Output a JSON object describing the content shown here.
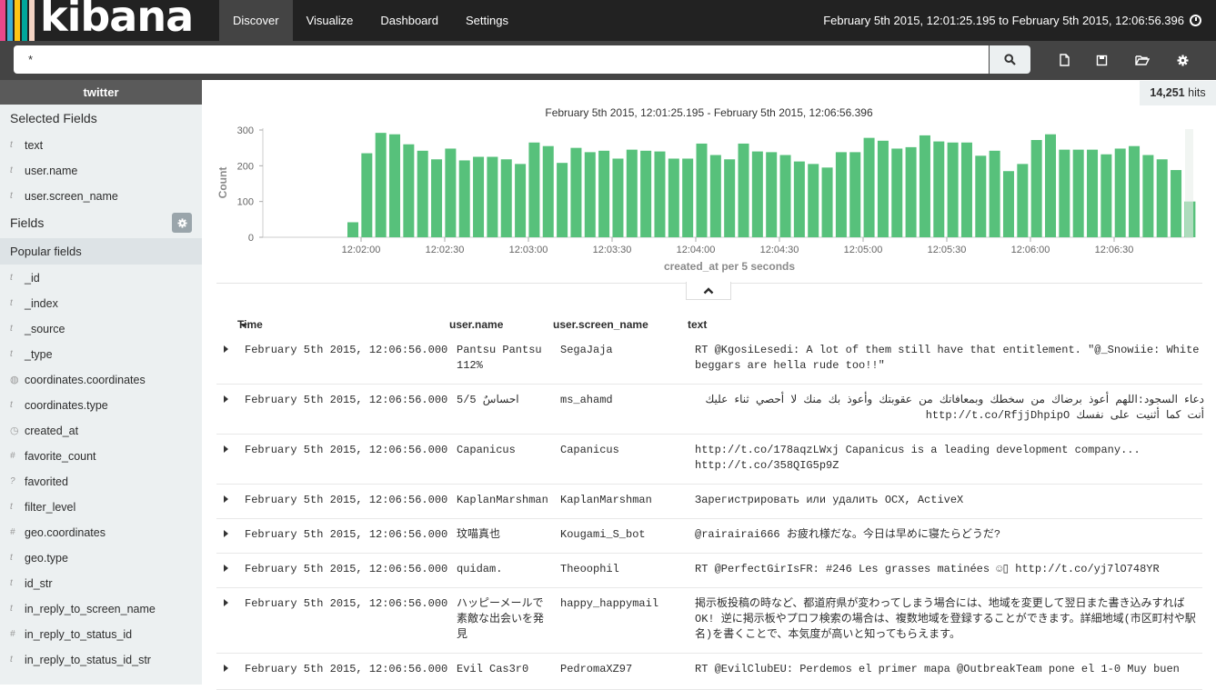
{
  "app": {
    "logo_text": "kibana",
    "logo_colors": [
      "#e8488b",
      "#3caed2",
      "#fec514",
      "#00a69b",
      "#f3d3c3"
    ]
  },
  "nav": {
    "tabs": [
      {
        "label": "Discover",
        "active": true
      },
      {
        "label": "Visualize",
        "active": false
      },
      {
        "label": "Dashboard",
        "active": false
      },
      {
        "label": "Settings",
        "active": false
      }
    ],
    "time_range": "February 5th 2015, 12:01:25.195 to February 5th 2015, 12:06:56.396",
    "time_icon": "clock-icon"
  },
  "search": {
    "query": "*",
    "button_icon": "search-icon",
    "tools": [
      "new-search-icon",
      "save-search-icon",
      "open-search-icon",
      "settings-icon"
    ]
  },
  "sidebar": {
    "index": "twitter",
    "selected_title": "Selected Fields",
    "selected_fields": [
      {
        "type": "t",
        "name": "text"
      },
      {
        "type": "t",
        "name": "user.name"
      },
      {
        "type": "t",
        "name": "user.screen_name"
      }
    ],
    "fields_title": "Fields",
    "popular_title": "Popular fields",
    "fields": [
      {
        "type": "t",
        "name": "_id"
      },
      {
        "type": "t",
        "name": "_index"
      },
      {
        "type": "t",
        "name": "_source"
      },
      {
        "type": "t",
        "name": "_type"
      },
      {
        "type": "geo",
        "name": "coordinates.coordinates"
      },
      {
        "type": "t",
        "name": "coordinates.type"
      },
      {
        "type": "date",
        "name": "created_at"
      },
      {
        "type": "#",
        "name": "favorite_count"
      },
      {
        "type": "?",
        "name": "favorited"
      },
      {
        "type": "t",
        "name": "filter_level"
      },
      {
        "type": "#",
        "name": "geo.coordinates"
      },
      {
        "type": "t",
        "name": "geo.type"
      },
      {
        "type": "t",
        "name": "id_str"
      },
      {
        "type": "t",
        "name": "in_reply_to_screen_name"
      },
      {
        "type": "#",
        "name": "in_reply_to_status_id"
      },
      {
        "type": "t",
        "name": "in_reply_to_status_id_str"
      }
    ]
  },
  "hits": {
    "count": "14,251",
    "label": "hits"
  },
  "chart_data": {
    "type": "bar",
    "title": "February 5th 2015, 12:01:25.195 - February 5th 2015, 12:06:56.396",
    "xlabel": "created_at per 5 seconds",
    "ylabel": "Count",
    "ylim": [
      0,
      300
    ],
    "yticks": [
      0,
      100,
      200,
      300
    ],
    "xticks": [
      "12:02:00",
      "12:02:30",
      "12:03:00",
      "12:03:30",
      "12:04:00",
      "12:04:30",
      "12:05:00",
      "12:05:30",
      "12:06:00",
      "12:06:30"
    ],
    "bar_color": "#57c17b",
    "values": [
      42,
      235,
      292,
      288,
      260,
      242,
      218,
      248,
      215,
      225,
      225,
      218,
      205,
      265,
      255,
      208,
      250,
      238,
      242,
      220,
      245,
      242,
      240,
      220,
      220,
      262,
      230,
      218,
      262,
      240,
      238,
      230,
      212,
      205,
      195,
      238,
      238,
      278,
      270,
      248,
      252,
      285,
      268,
      265,
      265,
      228,
      242,
      185,
      205,
      272,
      288,
      245,
      245,
      245,
      232,
      248,
      255,
      230,
      218,
      188,
      100
    ]
  },
  "table": {
    "columns": [
      "Time",
      "user.name",
      "user.screen_name",
      "text"
    ],
    "rows": [
      {
        "time": "February 5th 2015, 12:06:56.000",
        "user_name": "Pantsu Pantsu 112%",
        "screen_name": "SegaJaja",
        "text": "RT @KgosiLesedi: A lot of them still have that entitlement. \"@_Snowiie: White beggars are hella rude too!!\""
      },
      {
        "time": "February 5th 2015, 12:06:56.000",
        "user_name": "احساسٌ 5/5",
        "screen_name": "ms_ahamd",
        "text": "دعاء السجود:اللهم أعوذ برضاك من سخطك وبمعافاتك من عقوبتك وأعوذ بك منك لا أحصي ثناء عليك أنت كما أثنيت على نفسك http://t.co/RfjjDhpipO"
      },
      {
        "time": "February 5th 2015, 12:06:56.000",
        "user_name": "Capanicus",
        "screen_name": "Capanicus",
        "text": "http://t.co/178aqzLWxj Capanicus is a leading development company... http://t.co/358QIG5p9Z"
      },
      {
        "time": "February 5th 2015, 12:06:56.000",
        "user_name": "KaplanMarshman",
        "screen_name": "KaplanMarshman",
        "text": "Зарегистрировать или удалить OCX, ActiveX"
      },
      {
        "time": "February 5th 2015, 12:06:56.000",
        "user_name": "玟喵真也",
        "screen_name": "Kougami_S_bot",
        "text": "@rairairai666 お疲れ様だな。今日は早めに寝たらどうだ?"
      },
      {
        "time": "February 5th 2015, 12:06:56.000",
        "user_name": "quidam.",
        "screen_name": "Theoophil",
        "text": "RT @PerfectGirIsFR: #246 Les grasses matinées ☺▯ http://t.co/yj7lO748YR"
      },
      {
        "time": "February 5th 2015, 12:06:56.000",
        "user_name": "ハッピーメールで素敵な出会いを発見",
        "screen_name": "happy_happymail",
        "text": "掲示板投稿の時など、都道府県が変わってしまう場合には、地域を変更して翌日また書き込みすればOK! 逆に掲示板やプロフ検索の場合は、複数地域を登録することができます。詳細地域(市区町村や駅名)を書くことで、本気度が高いと知ってもらえます。"
      },
      {
        "time": "February 5th 2015, 12:06:56.000",
        "user_name": "Evil Cas3r0",
        "screen_name": "PedromaXZ97",
        "text": "RT @EvilClubEU: Perdemos el primer mapa @OutbreakTeam pone el 1-0 Muy buen"
      }
    ]
  }
}
